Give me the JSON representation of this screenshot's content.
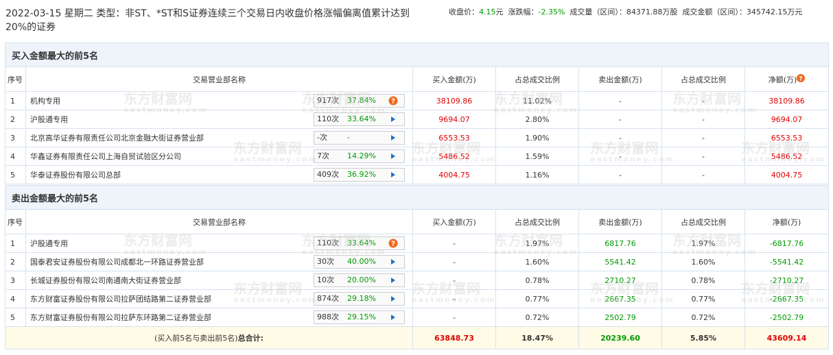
{
  "header": {
    "title": "2022-03-15 星期二 类型：非ST、*ST和S证券连续三个交易日内收盘价格涨幅偏离值累计达到20%的证券",
    "close_label": "收盘价：",
    "close_value": "4.15",
    "close_unit": "元",
    "change_label": "涨跌幅：",
    "change_value": "-2.35%",
    "volume_label": "成交量（区间）：",
    "volume_value": "84371.88万股",
    "amount_label": "成交金额（区间）：",
    "amount_value": "345742.15万元"
  },
  "columns": {
    "seq": "序号",
    "dept": "交易营业部名称",
    "buy": "买入金额(万)",
    "buy_ratio": "占总成交比例",
    "sell": "卖出金额(万)",
    "sell_ratio": "占总成交比例",
    "net": "净额(万)"
  },
  "buy_section": {
    "title": "买入金额最大的前5名",
    "rows": [
      {
        "seq": "1",
        "name": "机构专用",
        "count": "917次",
        "rate": "37.84%",
        "icon": "question-icon",
        "buy": "38109.86",
        "buy_ratio": "11.02%",
        "sell": "-",
        "sell_ratio": "-",
        "net": "38109.86"
      },
      {
        "seq": "2",
        "name": "沪股通专用",
        "count": "110次",
        "rate": "33.64%",
        "icon": "play-arrow-icon",
        "buy": "9694.07",
        "buy_ratio": "2.80%",
        "sell": "-",
        "sell_ratio": "-",
        "net": "9694.07"
      },
      {
        "seq": "3",
        "name": "北京高华证券有限责任公司北京金融大街证券营业部",
        "count": "-次",
        "rate": "-",
        "icon": "play-arrow-icon",
        "buy": "6553.53",
        "buy_ratio": "1.90%",
        "sell": "-",
        "sell_ratio": "-",
        "net": "6553.53"
      },
      {
        "seq": "4",
        "name": "华鑫证券有限责任公司上海自贸试验区分公司",
        "count": "7次",
        "rate": "14.29%",
        "icon": "play-arrow-icon",
        "buy": "5486.52",
        "buy_ratio": "1.59%",
        "sell": "-",
        "sell_ratio": "-",
        "net": "5486.52"
      },
      {
        "seq": "5",
        "name": "华泰证券股份有限公司总部",
        "count": "409次",
        "rate": "36.92%",
        "icon": "play-arrow-icon",
        "buy": "4004.75",
        "buy_ratio": "1.16%",
        "sell": "-",
        "sell_ratio": "-",
        "net": "4004.75"
      }
    ]
  },
  "sell_section": {
    "title": "卖出金额最大的前5名",
    "rows": [
      {
        "seq": "1",
        "name": "沪股通专用",
        "count": "110次",
        "rate": "33.64%",
        "icon": "question-icon",
        "buy": "-",
        "buy_ratio": "1.97%",
        "sell": "6817.76",
        "sell_ratio": "1.97%",
        "net": "-6817.76"
      },
      {
        "seq": "2",
        "name": "国泰君安证券股份有限公司成都北一环路证券营业部",
        "count": "30次",
        "rate": "40.00%",
        "icon": "play-arrow-icon",
        "buy": "-",
        "buy_ratio": "1.60%",
        "sell": "5541.42",
        "sell_ratio": "1.60%",
        "net": "-5541.42"
      },
      {
        "seq": "3",
        "name": "长城证券股份有限公司南通南大街证券营业部",
        "count": "10次",
        "rate": "20.00%",
        "icon": "play-arrow-icon",
        "buy": "-",
        "buy_ratio": "0.78%",
        "sell": "2710.27",
        "sell_ratio": "0.78%",
        "net": "-2710.27"
      },
      {
        "seq": "4",
        "name": "东方财富证券股份有限公司拉萨团结路第二证券营业部",
        "count": "874次",
        "rate": "29.18%",
        "icon": "play-arrow-icon",
        "buy": "-",
        "buy_ratio": "0.77%",
        "sell": "2667.35",
        "sell_ratio": "0.77%",
        "net": "-2667.35"
      },
      {
        "seq": "5",
        "name": "东方财富证券股份有限公司拉萨东环路第二证券营业部",
        "count": "988次",
        "rate": "29.15%",
        "icon": "play-arrow-icon",
        "buy": "-",
        "buy_ratio": "0.72%",
        "sell": "2502.79",
        "sell_ratio": "0.72%",
        "net": "-2502.79"
      }
    ]
  },
  "total": {
    "label_prefix": "(买入前5名与卖出前5名)",
    "label_bold": "总合计:",
    "buy": "63848.73",
    "buy_ratio": "18.47%",
    "sell": "20239.60",
    "sell_ratio": "5.85%",
    "net": "43609.14"
  },
  "watermark": {
    "cn": "东方财富网",
    "en": "eastmoney.com"
  },
  "colors": {
    "red": "#e00000",
    "green": "#009900",
    "border": "#d4e2f0",
    "section_bg": "#eef4fa",
    "total_bg": "#fffbe6",
    "icon_orange": "#f06a1d",
    "icon_blue": "#1e6fc8"
  }
}
